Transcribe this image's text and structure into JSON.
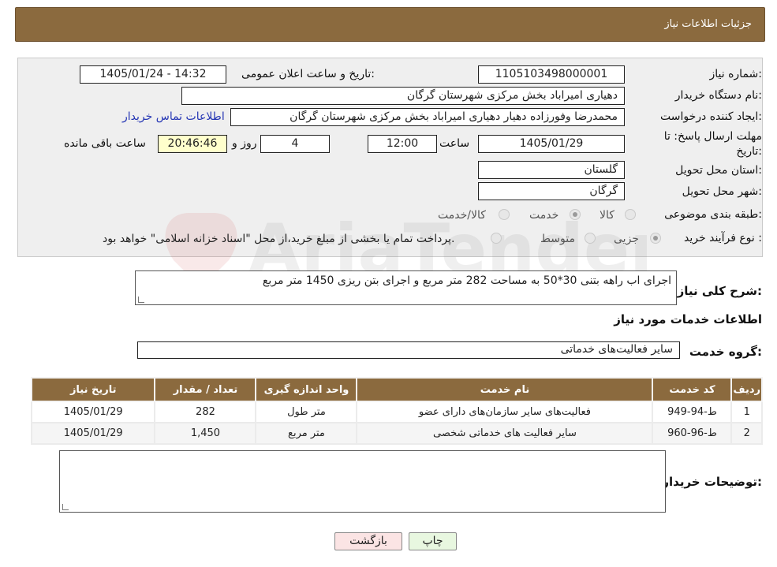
{
  "header": {
    "title": "جزئیات اطلاعات نیاز"
  },
  "form": {
    "need_number": {
      "label": "شماره نیاز:",
      "value": "1105103498000001"
    },
    "announce_datetime": {
      "label": "تاریخ و ساعت اعلان عمومی:",
      "value": "1405/01/24 - 14:32"
    },
    "buyer_org": {
      "label": "نام دستگاه خریدار:",
      "value": "دهیاری امیراباد بخش مرکزی شهرستان گرگان"
    },
    "requester": {
      "label": "ایجاد کننده درخواست:",
      "value": "محمدرضا وفورزاده دهیار دهیاری امیراباد بخش مرکزی شهرستان گرگان",
      "contact_link": "اطلاعات تماس خریدار"
    },
    "deadline": {
      "label_line1": "مهلت ارسال پاسخ: تا",
      "label_line2": "تاریخ:",
      "date": "1405/01/29",
      "time_label": "ساعت",
      "time": "12:00",
      "days": "4",
      "days_label": "روز و",
      "remaining": "20:46:46",
      "remaining_label": "ساعت باقی مانده"
    },
    "province": {
      "label": "استان محل تحویل:",
      "value": "گلستان"
    },
    "city": {
      "label": "شهر محل تحویل:",
      "value": "گرگان"
    },
    "category": {
      "label": "طبقه بندی موضوعی:",
      "options": [
        "کالا",
        "خدمت",
        "کالا/خدمت"
      ],
      "selected": "خدمت"
    },
    "purchase_type": {
      "label": "نوع فرآیند خرید :",
      "options": [
        "جزیی",
        "متوسط"
      ],
      "note": "پرداخت تمام یا بخشی از مبلغ خرید،از محل \"اسناد خزانه اسلامی\" خواهد بود."
    }
  },
  "description": {
    "label": "شرح کلی نیاز:",
    "value": "اجرای اب راهه بتنی 30*50 به مساحت 282 متر مربع و اجرای بتن ریزی 1450 متر مربع"
  },
  "services": {
    "section_title": "اطلاعات خدمات مورد نیاز",
    "group_label": "گروه خدمت:",
    "group_value": "سایر فعالیت‌های خدماتی"
  },
  "table": {
    "headers": [
      "ردیف",
      "کد خدمت",
      "نام خدمت",
      "واحد اندازه گیری",
      "تعداد / مقدار",
      "تاریخ نیاز"
    ],
    "rows": [
      [
        "1",
        "ط-94-949",
        "فعالیت‌های سایر سازمان‌های دارای عضو",
        "متر طول",
        "282",
        "1405/01/29"
      ],
      [
        "2",
        "ط-96-960",
        "سایر فعالیت های خدماتی شخصی",
        "متر مربع",
        "1,450",
        "1405/01/29"
      ]
    ]
  },
  "buyer_notes": {
    "label": "توضیحات خریدار:",
    "value": ""
  },
  "buttons": {
    "print": "چاپ",
    "back": "بازگشت"
  },
  "watermark": {
    "text": "AriaTender.net"
  },
  "colors": {
    "header_brown": "#8b6a3e",
    "print_bg": "#e8f7e0",
    "back_bg": "#fbe4e4"
  }
}
